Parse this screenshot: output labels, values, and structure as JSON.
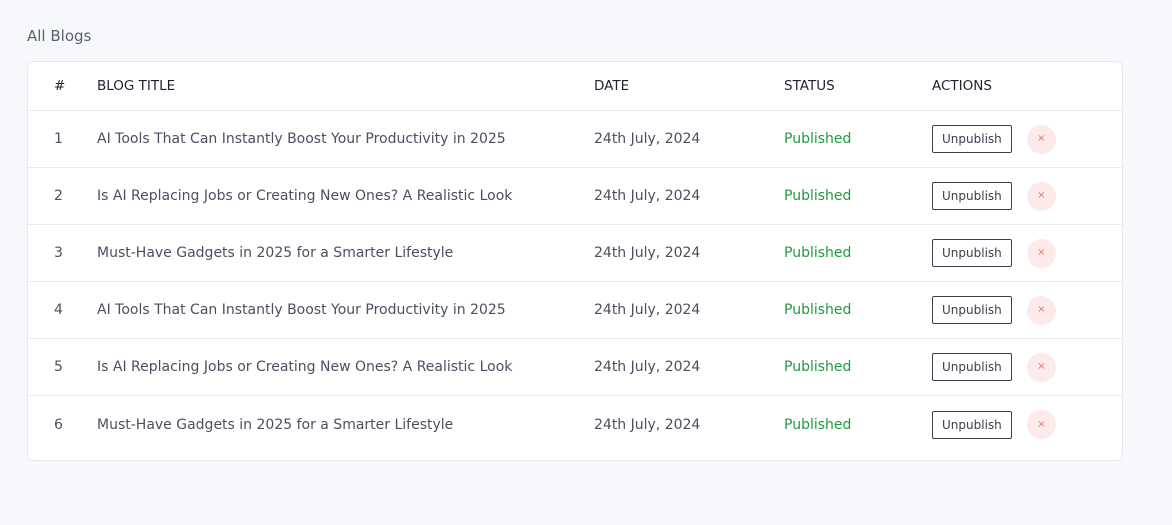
{
  "page": {
    "title": "All Blogs"
  },
  "table": {
    "headers": {
      "num": "#",
      "title": "BLOG TITLE",
      "date": "DATE",
      "status": "STATUS",
      "actions": "ACTIONS"
    },
    "rows": [
      {
        "num": "1",
        "title": "AI Tools That Can Instantly Boost Your Productivity in 2025",
        "date": "24th July, 2024",
        "status": "Published",
        "action_label": "Unpublish",
        "delete_icon": "×"
      },
      {
        "num": "2",
        "title": "Is AI Replacing Jobs or Creating New Ones? A Realistic Look",
        "date": "24th July, 2024",
        "status": "Published",
        "action_label": "Unpublish",
        "delete_icon": "×"
      },
      {
        "num": "3",
        "title": "Must-Have Gadgets in 2025 for a Smarter Lifestyle",
        "date": "24th July, 2024",
        "status": "Published",
        "action_label": "Unpublish",
        "delete_icon": "×"
      },
      {
        "num": "4",
        "title": "AI Tools That Can Instantly Boost Your Productivity in 2025",
        "date": "24th July, 2024",
        "status": "Published",
        "action_label": "Unpublish",
        "delete_icon": "×"
      },
      {
        "num": "5",
        "title": "Is AI Replacing Jobs or Creating New Ones? A Realistic Look",
        "date": "24th July, 2024",
        "status": "Published",
        "action_label": "Unpublish",
        "delete_icon": "×"
      },
      {
        "num": "6",
        "title": "Must-Have Gadgets in 2025 for a Smarter Lifestyle",
        "date": "24th July, 2024",
        "status": "Published",
        "action_label": "Unpublish",
        "delete_icon": "×"
      }
    ]
  },
  "colors": {
    "background": "#f7f8fc",
    "published": "#1f9b3f",
    "delete_bg": "#fdeaea",
    "delete_icon": "#e2736f"
  }
}
